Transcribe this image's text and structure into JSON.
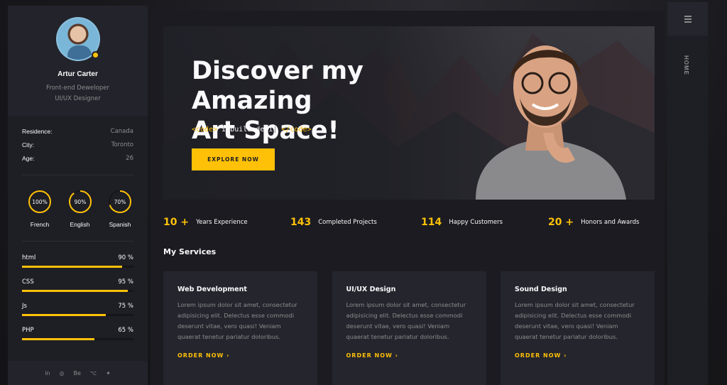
{
  "profile": {
    "name": "Artur Carter",
    "role_line1": "Front-end Deweloper",
    "role_line2": "UI/UX Designer"
  },
  "info": [
    {
      "key": "Residence:",
      "value": "Canada"
    },
    {
      "key": "City:",
      "value": "Toronto"
    },
    {
      "key": "Age:",
      "value": "26"
    }
  ],
  "languages": [
    {
      "name": "French",
      "percent_label": "100%",
      "level": 1.0
    },
    {
      "name": "English",
      "percent_label": "90%",
      "level": 0.9
    },
    {
      "name": "Spanish",
      "percent_label": "70%",
      "level": 0.7
    }
  ],
  "skills": [
    {
      "name": "html",
      "percent_label": "90 %",
      "level": 0.9
    },
    {
      "name": "CSS",
      "percent_label": "95 %",
      "level": 0.95
    },
    {
      "name": "Js",
      "percent_label": "75 %",
      "level": 0.75
    },
    {
      "name": "PHP",
      "percent_label": "65 %",
      "level": 0.65
    }
  ],
  "social": [
    "in",
    "◎",
    "Be",
    "⌥",
    "✦"
  ],
  "social_icons": [
    "linkedin-icon",
    "dribbble-icon",
    "behance-icon",
    "github-icon",
    "twitter-icon"
  ],
  "rightbar": {
    "home_label": "HOME",
    "menu_icon": "hamburger-icon"
  },
  "hero": {
    "title_line1": "Discover my Amazing",
    "title_line2": "Art Space!",
    "code_open": "<code>",
    "code_text": " I build desi",
    "code_cursor": "|",
    "code_close": " </code>",
    "button": "EXPLORE NOW"
  },
  "stats": [
    {
      "number": "10 +",
      "label": "Years Experience"
    },
    {
      "number": "143",
      "label": "Completed Projects"
    },
    {
      "number": "114",
      "label": "Happy Customers"
    },
    {
      "number": "20 +",
      "label": "Honors and Awards"
    }
  ],
  "services_title": "My Services",
  "services": [
    {
      "title": "Web Development",
      "text": "Lorem ipsum dolor sit amet, consectetur adipisicing elit. Delectus esse commodi deserunt vitae, vero quasi! Veniam quaerat tenetur pariatur doloribus.",
      "link": "ORDER NOW  ›"
    },
    {
      "title": "UI/UX Design",
      "text": "Lorem ipsum dolor sit amet, consectetur adipisicing elit. Delectus esse commodi deserunt vitae, vero quasi! Veniam quaerat tenetur pariatur doloribus.",
      "link": "ORDER NOW  ›"
    },
    {
      "title": "Sound Design",
      "text": "Lorem ipsum dolor sit amet, consectetur adipisicing elit. Delectus esse commodi deserunt vitae, vero quasi! Veniam quaerat tenetur pariatur doloribus.",
      "link": "ORDER NOW  ›"
    }
  ],
  "colors": {
    "accent": "#ffc107",
    "background": "#1e1e25",
    "card": "#25252d",
    "muted_text": "#8c8c8e"
  }
}
